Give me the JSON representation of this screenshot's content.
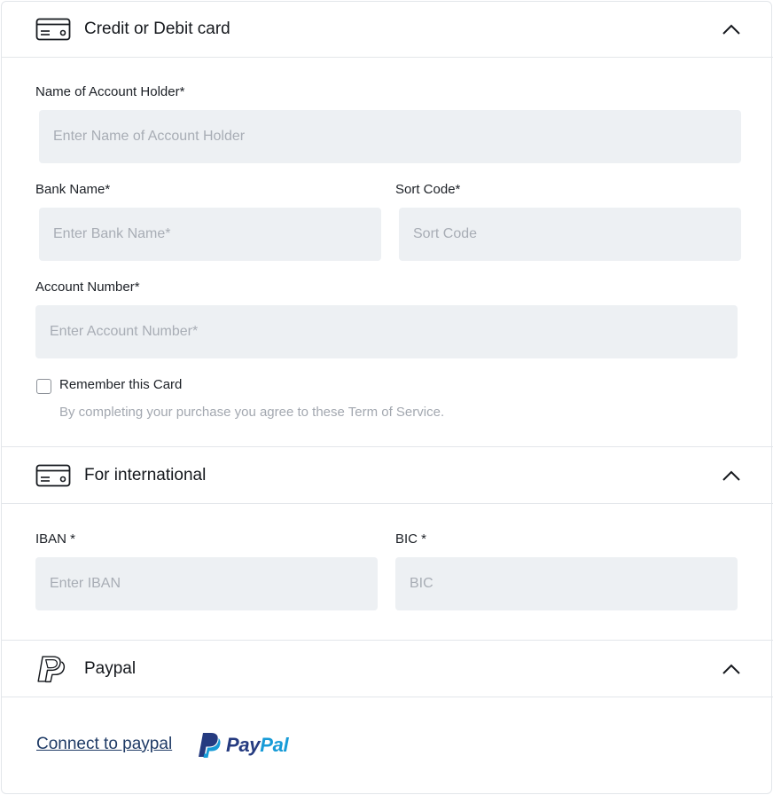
{
  "card_section": {
    "title": "Credit or Debit card",
    "icon": "credit-card-icon",
    "fields": {
      "account_holder": {
        "label": "Name of Account Holder*",
        "placeholder": "Enter Name of Account Holder",
        "value": ""
      },
      "bank_name": {
        "label": "Bank Name*",
        "placeholder": "Enter Bank Name*",
        "value": ""
      },
      "sort_code": {
        "label": "Sort Code*",
        "placeholder": "Sort Code",
        "value": ""
      },
      "account_number": {
        "label": "Account Number*",
        "placeholder": "Enter Account Number*",
        "value": ""
      }
    },
    "remember_label": "Remember this Card",
    "remember_checked": false,
    "terms_note": "By completing your purchase you agree to these Term of Service."
  },
  "international_section": {
    "title": "For international",
    "icon": "credit-card-icon",
    "fields": {
      "iban": {
        "label": "IBAN *",
        "placeholder": "Enter IBAN",
        "value": ""
      },
      "bic": {
        "label": "BIC *",
        "placeholder": "BIC",
        "value": ""
      }
    }
  },
  "paypal_section": {
    "title": "Paypal",
    "icon": "paypal-icon",
    "connect_link": "Connect to paypal",
    "logo_text_pay": "Pay",
    "logo_text_pal": "Pal"
  },
  "colors": {
    "input_bg": "#edf0f3",
    "border": "#e3e6ea",
    "link": "#1f3b66",
    "paypal_dark_blue": "#253b80",
    "paypal_light_blue": "#179bd7"
  }
}
